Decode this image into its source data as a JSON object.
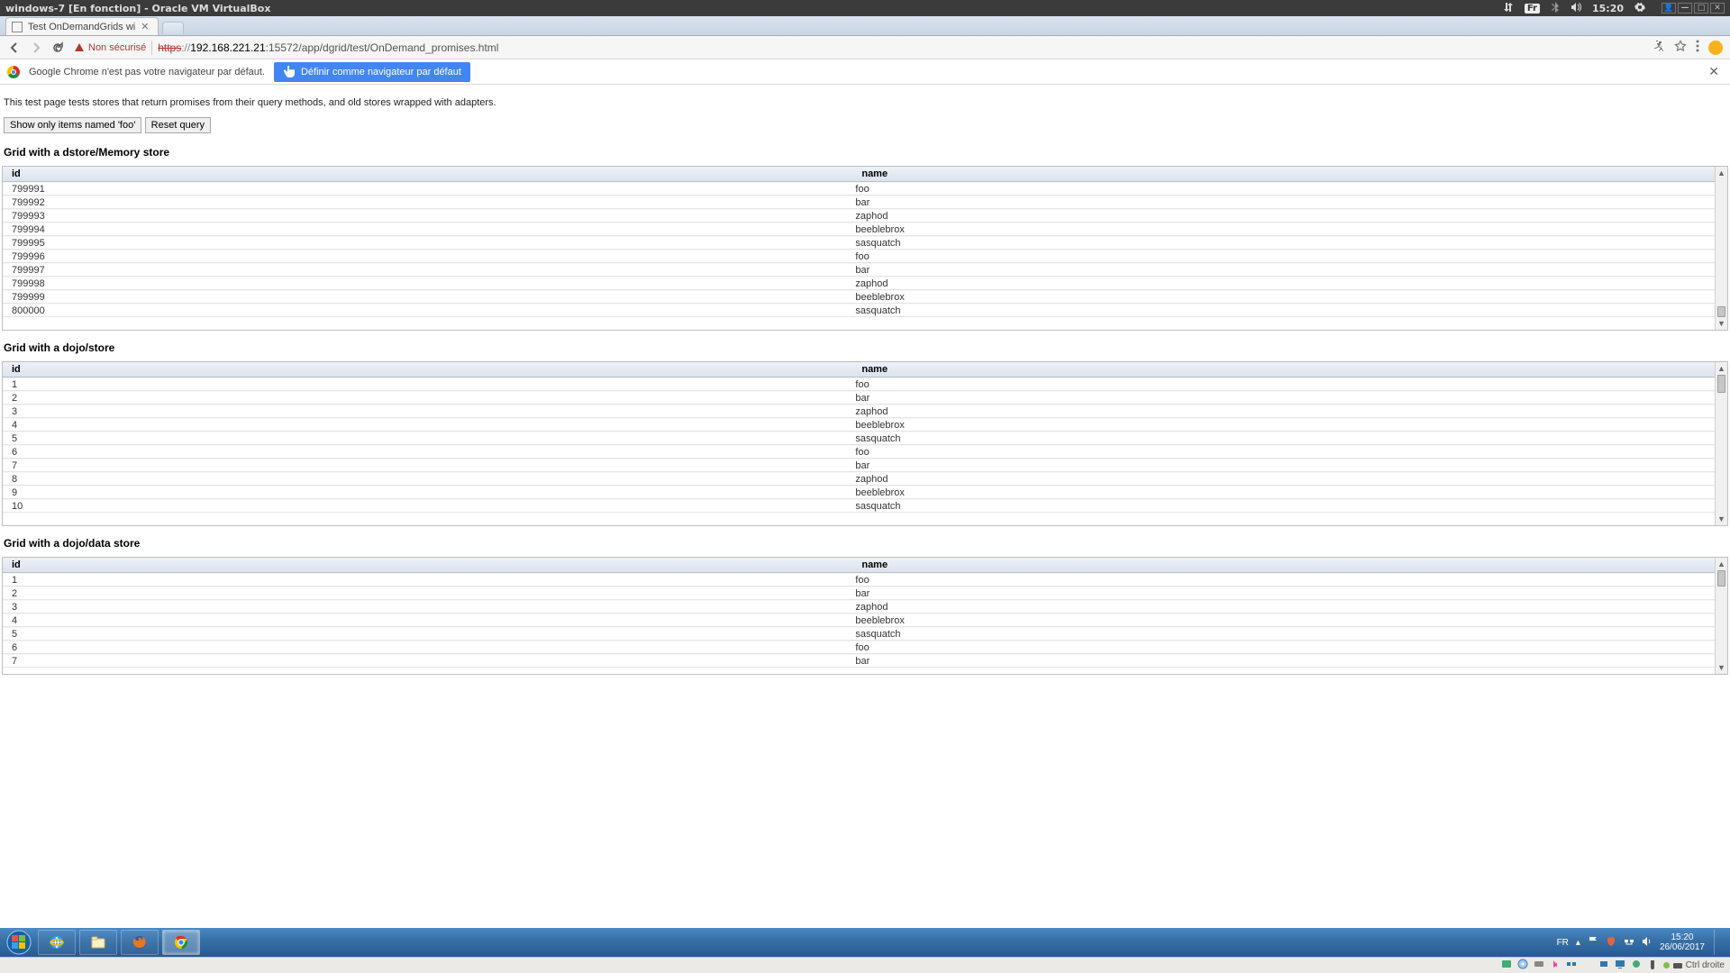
{
  "ubuntu": {
    "title": "windows-7 [En fonction] - Oracle VM VirtualBox",
    "keyboard_layout": "Fr",
    "clock": "15:20"
  },
  "chrome": {
    "tab_title": "Test OnDemandGrids wi",
    "insecure_label": "Non sécurisé",
    "url_proto": "https",
    "url_rest": "//192.168.221.21:15572/app/dgrid/test/OnDemand_promises.html",
    "url_host": "192.168.221.21",
    "url_path": ":15572/app/dgrid/test/OnDemand_promises.html",
    "infobar_text": "Google Chrome n'est pas votre navigateur par défaut.",
    "default_btn": "Définir comme navigateur par défaut"
  },
  "page": {
    "intro": "This test page tests stores that return promises from their query methods, and old stores wrapped with adapters.",
    "btn_filter": "Show only items named 'foo'",
    "btn_reset": "Reset query",
    "headings": {
      "grid1": "Grid with a dstore/Memory store",
      "grid2": "Grid with a dojo/store",
      "grid3": "Grid with a dojo/data store"
    },
    "columns": {
      "id": "id",
      "name": "name"
    },
    "grid1_rows": [
      {
        "id": "799991",
        "name": "foo"
      },
      {
        "id": "799992",
        "name": "bar"
      },
      {
        "id": "799993",
        "name": "zaphod"
      },
      {
        "id": "799994",
        "name": "beeblebrox"
      },
      {
        "id": "799995",
        "name": "sasquatch"
      },
      {
        "id": "799996",
        "name": "foo"
      },
      {
        "id": "799997",
        "name": "bar"
      },
      {
        "id": "799998",
        "name": "zaphod"
      },
      {
        "id": "799999",
        "name": "beeblebrox"
      },
      {
        "id": "800000",
        "name": "sasquatch"
      }
    ],
    "grid2_rows": [
      {
        "id": "1",
        "name": "foo"
      },
      {
        "id": "2",
        "name": "bar"
      },
      {
        "id": "3",
        "name": "zaphod"
      },
      {
        "id": "4",
        "name": "beeblebrox"
      },
      {
        "id": "5",
        "name": "sasquatch"
      },
      {
        "id": "6",
        "name": "foo"
      },
      {
        "id": "7",
        "name": "bar"
      },
      {
        "id": "8",
        "name": "zaphod"
      },
      {
        "id": "9",
        "name": "beeblebrox"
      },
      {
        "id": "10",
        "name": "sasquatch"
      }
    ],
    "grid3_rows": [
      {
        "id": "1",
        "name": "foo"
      },
      {
        "id": "2",
        "name": "bar"
      },
      {
        "id": "3",
        "name": "zaphod"
      },
      {
        "id": "4",
        "name": "beeblebrox"
      },
      {
        "id": "5",
        "name": "sasquatch"
      },
      {
        "id": "6",
        "name": "foo"
      },
      {
        "id": "7",
        "name": "bar"
      }
    ]
  },
  "win7": {
    "tray_lang": "FR",
    "tray_time": "15:20",
    "tray_date": "26/06/2017"
  },
  "vbox": {
    "ctrl_label": "Ctrl droite"
  }
}
